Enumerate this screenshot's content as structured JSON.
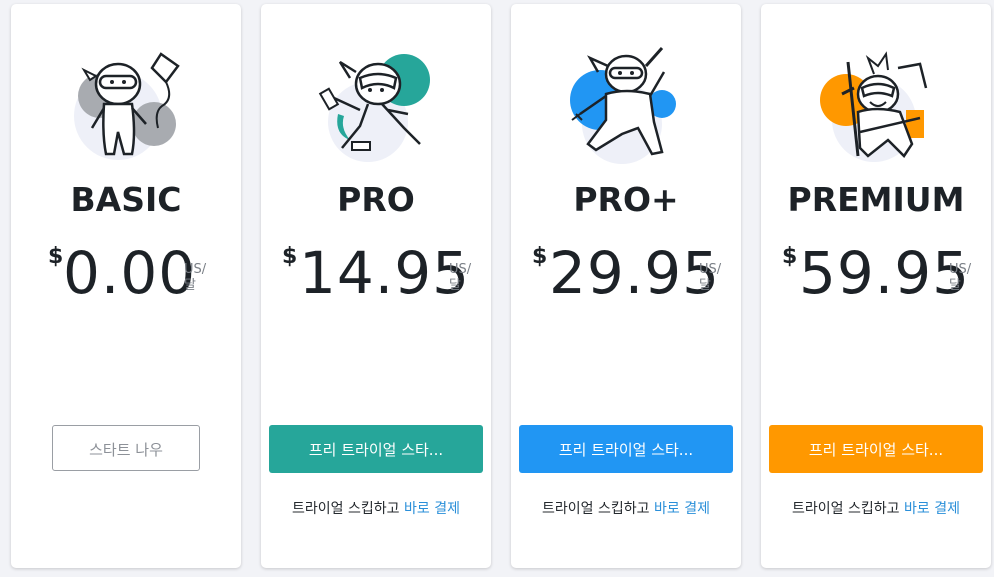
{
  "colors": {
    "pro": "#26a69a",
    "pro_plus": "#2196f3",
    "premium": "#ff9800",
    "link": "#2a8fd9"
  },
  "plans": [
    {
      "name": "BASIC",
      "currency": "$",
      "amount": "0.00",
      "unit_top": "US/",
      "unit_bottom": "달",
      "cta_label": "스타트 나우",
      "mascot_icon": "ninja-with-kite-icon"
    },
    {
      "name": "PRO",
      "currency": "$",
      "amount": "14.95",
      "unit_top": "US/",
      "unit_bottom": "달",
      "cta_label": "프리 트라이얼 스타...",
      "skip_text": "트라이얼 스킵하고",
      "skip_link": "바로 결제",
      "mascot_icon": "ninja-nunchaku-icon"
    },
    {
      "name": "PRO+",
      "currency": "$",
      "amount": "29.95",
      "unit_top": "US/",
      "unit_bottom": "달",
      "cta_label": "프리 트라이얼 스타...",
      "skip_text": "트라이얼 스킵하고",
      "skip_link": "바로 결제",
      "mascot_icon": "ninja-sword-icon"
    },
    {
      "name": "PREMIUM",
      "currency": "$",
      "amount": "59.95",
      "unit_top": "US/",
      "unit_bottom": "달",
      "cta_label": "프리 트라이얼 스타...",
      "skip_text": "트라이얼 스킵하고",
      "skip_link": "바로 결제",
      "mascot_icon": "ninja-master-icon"
    }
  ]
}
